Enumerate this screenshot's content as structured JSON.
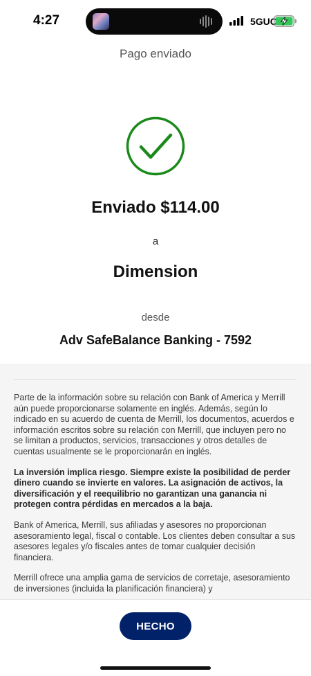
{
  "status_bar": {
    "time": "4:27",
    "network": "5GUC",
    "icons": [
      "signal-icon",
      "battery-charging-icon",
      "audio-wave-icon"
    ]
  },
  "header": {
    "title": "Pago enviado"
  },
  "confirmation": {
    "icon": "checkmark-circle-icon",
    "icon_color": "#1a8a1a",
    "sent_amount": "Enviado $114.00",
    "to_label": "a",
    "recipient": "Dimension",
    "from_label": "desde",
    "account": "Adv SafeBalance Banking - 7592"
  },
  "disclosures": [
    {
      "text": "Parte de la información sobre su relación con Bank of America y Merrill aún puede proporcionarse solamente en inglés. Además, según lo indicado en su acuerdo de cuenta de Merrill, los documentos, acuerdos e información escritos sobre su relación con Merrill, que incluyen pero no se limitan a productos, servicios, transacciones y otros detalles de cuentas usualmente se le proporcionarán en inglés.",
      "bold": false
    },
    {
      "text": "La inversión implica riesgo. Siempre existe la posibilidad de perder dinero cuando se invierte en valores. La asignación de activos, la diversificación y el reequilibrio no garantizan una ganancia ni protegen contra pérdidas en mercados a la baja.",
      "bold": true
    },
    {
      "text": "Bank of America, Merrill, sus afiliadas y asesores no proporcionan asesoramiento legal, fiscal o contable. Los clientes deben consultar a sus asesores legales y/o fiscales antes de tomar cualquier decisión financiera.",
      "bold": false
    },
    {
      "text": "Merrill ofrece una amplia gama de servicios de corretaje, asesoramiento de inversiones (incluida la planificación financiera) y",
      "bold": false
    }
  ],
  "footer": {
    "done_label": "HECHO",
    "button_color": "#012169"
  }
}
